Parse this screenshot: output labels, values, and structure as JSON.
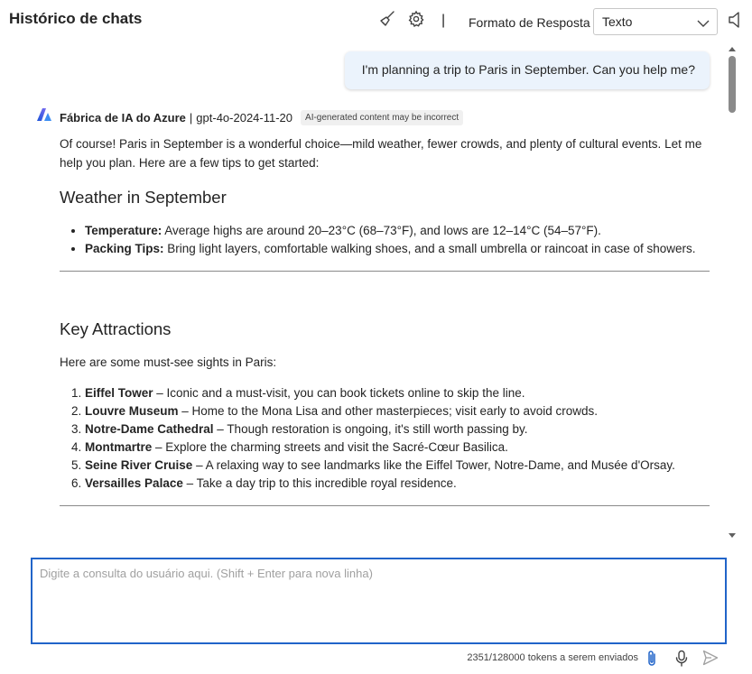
{
  "header": {
    "title": "Histórico de chats",
    "clear_icon": "broom-icon",
    "settings_icon": "gear-icon",
    "separator": "|",
    "format_label": "Formato de Resposta",
    "format_value": "Texto",
    "speaker_icon": "speaker-icon"
  },
  "user_message": {
    "text": "I'm planning a trip to Paris in September. Can you help me?"
  },
  "ai_message": {
    "provider": "Fábrica de IA do Azure",
    "separator": "|",
    "model": "gpt-4o-2024-11-20",
    "badge": "AI-generated content may be incorrect",
    "intro": "Of course! Paris in September is a wonderful choice—mild weather, fewer crowds, and plenty of cultural events. Let me help you plan. Here are a few tips to get started:",
    "sections": [
      {
        "heading": "Weather in September",
        "bullets": [
          {
            "label": "Temperature:",
            "text": " Average highs are around 20–23°C (68–73°F), and lows are 12–14°C (54–57°F)."
          },
          {
            "label": "Packing Tips:",
            "text": " Bring light layers, comfortable walking shoes, and a small umbrella or raincoat in case of showers."
          }
        ]
      },
      {
        "heading": "Key Attractions",
        "intro": "Here are some must-see sights in Paris:",
        "items": [
          {
            "label": "Eiffel Tower",
            "text": " – Iconic and a must-visit, you can book tickets online to skip the line."
          },
          {
            "label": "Louvre Museum",
            "text": " – Home to the Mona Lisa and other masterpieces; visit early to avoid crowds."
          },
          {
            "label": "Notre-Dame Cathedral",
            "text": " – Though restoration is ongoing, it's still worth passing by."
          },
          {
            "label": "Montmartre",
            "text": " – Explore the charming streets and visit the Sacré-Cœur Basilica."
          },
          {
            "label": "Seine River Cruise",
            "text": " – A relaxing way to see landmarks like the Eiffel Tower, Notre-Dame, and Musée d'Orsay."
          },
          {
            "label": "Versailles Palace",
            "text": " – Take a day trip to this incredible royal residence."
          }
        ]
      }
    ]
  },
  "input": {
    "placeholder": "Digite a consulta do usuário aqui. (Shift + Enter para nova linha)",
    "value": ""
  },
  "footer": {
    "token_count": "2351/128000 tokens a serem enviados",
    "attach_icon": "paperclip-icon",
    "mic_icon": "microphone-icon",
    "send_icon": "send-icon"
  },
  "colors": {
    "accent": "#2164c9",
    "user_bubble": "#ebf3fc",
    "badge_bg": "#f0f0f0"
  }
}
